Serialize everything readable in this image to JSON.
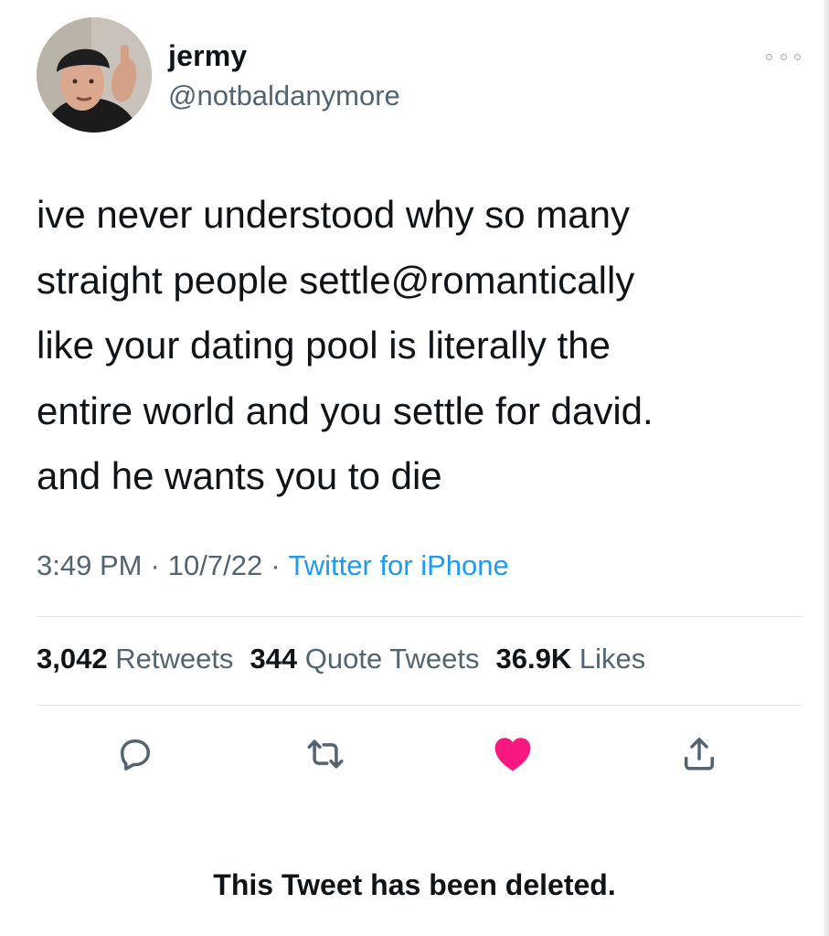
{
  "author": {
    "display_name": "jermy",
    "handle": "@notbaldanymore",
    "avatar_icon": "profile-photo"
  },
  "tweet": {
    "text": "ive never understood why so many\nstraight people settle@romantically\nlike your dating pool is literally the\nentire world and you settle for david.\nand he wants you to die",
    "time": "3:49 PM",
    "separator": "·",
    "date": "10/7/22",
    "source": "Twitter for iPhone"
  },
  "stats": {
    "retweets_count": "3,042",
    "retweets_label": "Retweets",
    "quotes_count": "344",
    "quotes_label": "Quote Tweets",
    "likes_count": "36.9K",
    "likes_label": "Likes"
  },
  "actions": {
    "reply_icon": "speech-bubble-icon",
    "retweet_icon": "retweet-arrows-icon",
    "like_icon": "heart-icon",
    "share_icon": "upload-icon",
    "like_color": "#f91880",
    "icon_color": "#536471"
  },
  "colors": {
    "link": "#1d9bf0",
    "secondary_text": "#536471",
    "primary_text": "#0f1419"
  },
  "footer": {
    "deleted_notice": "This Tweet has been deleted."
  }
}
